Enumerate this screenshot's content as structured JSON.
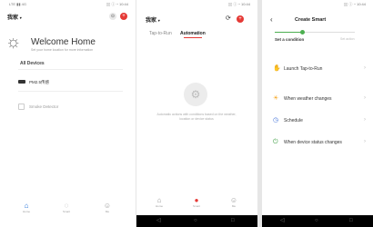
{
  "screen_home": {
    "status_left": "LTE ▮▮ 4G",
    "status_right": "▯▯ ⓘ ◔ 10:44",
    "home_label": "我家",
    "welcome_title": "Welcome Home",
    "welcome_subtitle": "Set your home location for more information",
    "section_title": "All Devices",
    "devices": [
      "PM2.5传感",
      "Smoke Detector"
    ],
    "nav": [
      "Home",
      "Smart",
      "Me"
    ]
  },
  "screen_smart": {
    "status_right": "▯▯ ⓘ ◔ 10:44",
    "home_label": "我家",
    "tabs": [
      "Tap-to-Run",
      "Automation"
    ],
    "empty_text": "Automatic actions with conditions based on the weather, location or device status",
    "nav": [
      "Home",
      "Smart",
      "Me"
    ]
  },
  "screen_create": {
    "status_right": "▯▯ ⓘ ◔ 10:44",
    "title": "Create Smart",
    "step_label": "Set a condition",
    "step_label_right": "Set action",
    "conditions": [
      {
        "label": "Launch Tap-to-Run",
        "icon": "hand-icon",
        "color": "#e53935"
      },
      {
        "label": "When weather changes",
        "icon": "sun-icon",
        "color": "#f5a623"
      },
      {
        "label": "Schedule",
        "icon": "clock-icon",
        "color": "#3f6fd8"
      },
      {
        "label": "When device status changes",
        "icon": "device-icon",
        "color": "#43a047"
      }
    ]
  },
  "colors": {
    "accent": "#e53935",
    "nav_active": "#1f6fd8",
    "progress": "#4caf50"
  }
}
